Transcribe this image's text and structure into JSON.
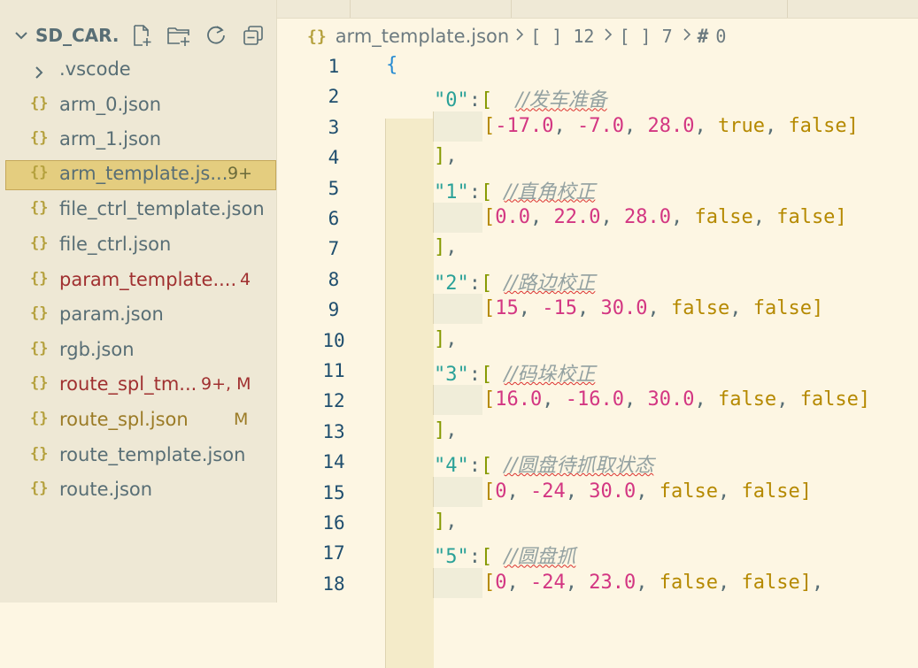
{
  "sidebar": {
    "title": "SD_CAR...",
    "actions": [
      "new-file-icon",
      "new-folder-icon",
      "refresh-icon",
      "collapse-all-icon"
    ],
    "items": [
      {
        "name": ".vscode",
        "type": "folder",
        "badge": ""
      },
      {
        "name": "arm_0.json",
        "type": "json",
        "badge": ""
      },
      {
        "name": "arm_1.json",
        "type": "json",
        "badge": ""
      },
      {
        "name": "arm_template.js...",
        "type": "json",
        "badge": "9+"
      },
      {
        "name": "file_ctrl_template.json",
        "type": "json",
        "badge": ""
      },
      {
        "name": "file_ctrl.json",
        "type": "json",
        "badge": ""
      },
      {
        "name": "param_template....",
        "type": "json",
        "badge": "4"
      },
      {
        "name": "param.json",
        "type": "json",
        "badge": ""
      },
      {
        "name": "rgb.json",
        "type": "json",
        "badge": ""
      },
      {
        "name": "route_spl_tm...",
        "type": "json",
        "badge": "9+, M"
      },
      {
        "name": "route_spl.json",
        "type": "json",
        "badge": "M"
      },
      {
        "name": "route_template.json",
        "type": "json",
        "badge": ""
      },
      {
        "name": "route.json",
        "type": "json",
        "badge": ""
      }
    ]
  },
  "breadcrumb": {
    "icon": "{}",
    "file": "arm_template.json",
    "seg1": "[ ] 12",
    "seg2": "[ ] 7",
    "seg3": "0"
  },
  "editor": {
    "line_numbers": [
      "1",
      "2",
      "3",
      "4",
      "5",
      "6",
      "7",
      "8",
      "9",
      "10",
      "11",
      "12",
      "13",
      "14",
      "15",
      "16",
      "17",
      "18"
    ],
    "entries": [
      {
        "key": "\"0\"",
        "comment": "//发车准备",
        "values": [
          "-17.0",
          "-7.0",
          "28.0",
          "true",
          "false"
        ]
      },
      {
        "key": "\"1\"",
        "comment": "//直角校正",
        "values": [
          "0.0",
          "22.0",
          "28.0",
          "false",
          "false"
        ]
      },
      {
        "key": "\"2\"",
        "comment": "//路边校正",
        "values": [
          "15",
          "-15",
          "30.0",
          "false",
          "false"
        ]
      },
      {
        "key": "\"3\"",
        "comment": "//码垛校正",
        "values": [
          "16.0",
          "-16.0",
          "30.0",
          "false",
          "false"
        ]
      },
      {
        "key": "\"4\"",
        "comment": "//圆盘待抓取状态",
        "values": [
          "0",
          "-24",
          "30.0",
          "false",
          "false"
        ]
      },
      {
        "key": "\"5\"",
        "comment": "//圆盘抓",
        "values": [
          "0",
          "-24",
          "23.0",
          "false",
          "false"
        ]
      }
    ]
  },
  "colors": {
    "background": "#fdf6e3",
    "sidebar": "#eee8d5",
    "active_item": "#e4cd7f",
    "key": "#2aa198",
    "number": "#d33682",
    "keyword": "#b58900",
    "brace": "#268bd2",
    "error": "#a03030"
  }
}
